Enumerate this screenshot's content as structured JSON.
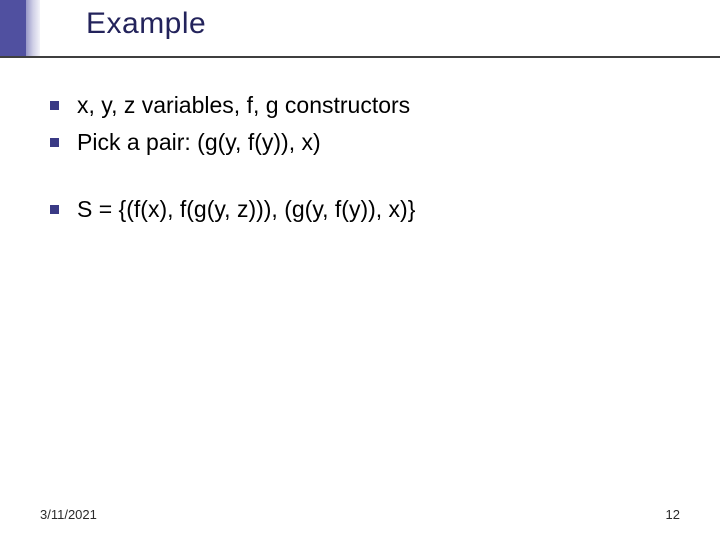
{
  "slide": {
    "title": "Example",
    "bullets": [
      "x, y, z variables, f, g constructors",
      "Pick a pair: (g(y, f(y)), x)",
      "S = {(f(x), f(g(y, z))), (g(y, f(y)), x)}"
    ],
    "date": "3/11/2021",
    "page": "12"
  }
}
